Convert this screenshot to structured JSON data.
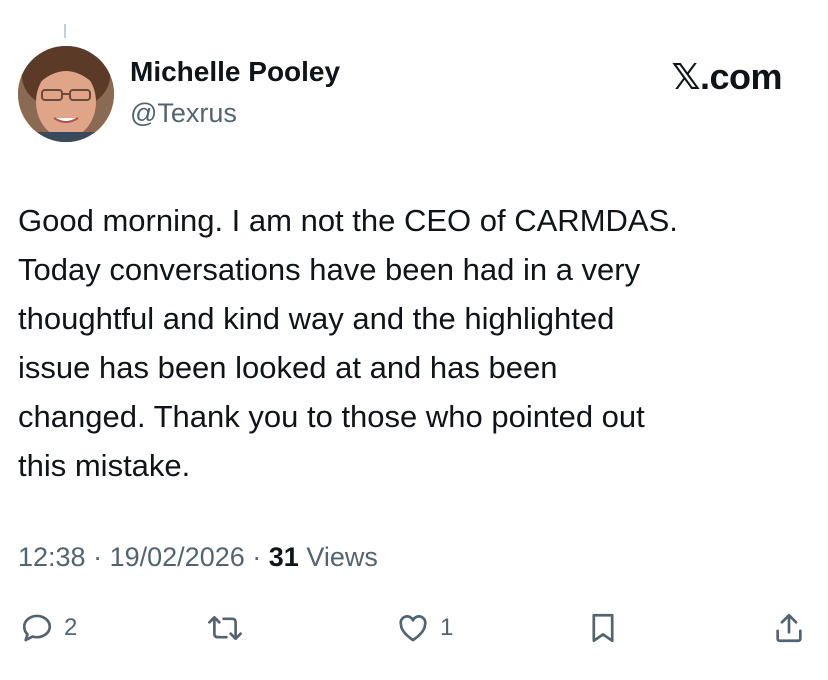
{
  "author": {
    "name": "Michelle Pooley",
    "handle": "@Texrus"
  },
  "brand": {
    "x_mark": "𝕏",
    "domain": ".com"
  },
  "tweet": {
    "lines": [
      "Good morning. I am not the CEO of CARMDAS.",
      "Today conversations have been had in a very",
      "thoughtful and kind way and the highlighted",
      "issue has been looked at and has been",
      "changed. Thank you to those who pointed out",
      "this mistake."
    ]
  },
  "meta": {
    "time": "12:38",
    "separator": "·",
    "date": "19/02/2026",
    "views_count": "31",
    "views_label": "Views"
  },
  "actions": {
    "reply_count": "2",
    "like_count": "1"
  },
  "colors": {
    "text": "#0f1419",
    "secondary": "#536471"
  },
  "icons": [
    "reply-icon",
    "retweet-icon",
    "like-icon",
    "bookmark-icon",
    "share-icon"
  ]
}
